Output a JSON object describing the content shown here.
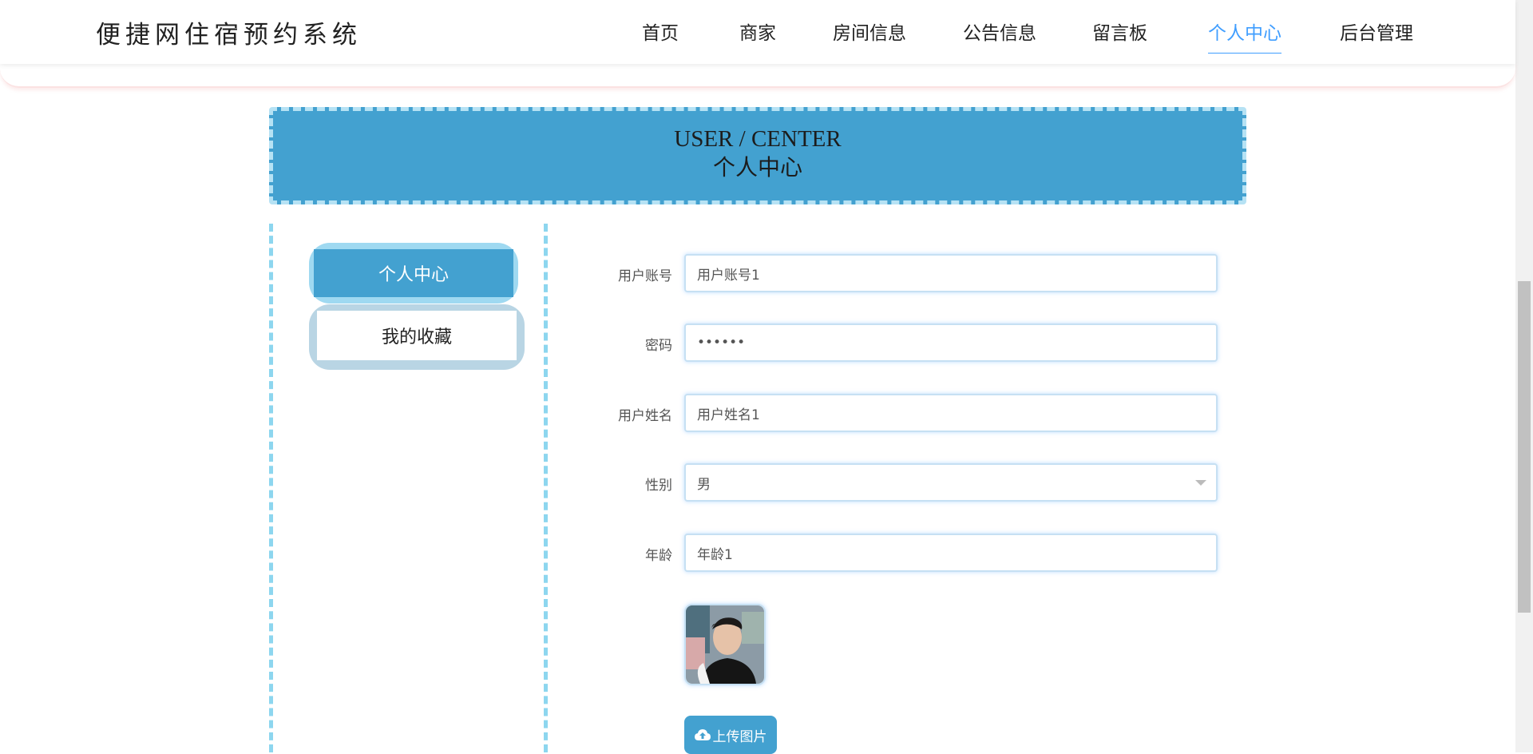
{
  "site": {
    "title": "便捷网住宿预约系统"
  },
  "nav": {
    "items": [
      {
        "label": "首页",
        "active": false
      },
      {
        "label": "商家",
        "active": false
      },
      {
        "label": "房间信息",
        "active": false
      },
      {
        "label": "公告信息",
        "active": false
      },
      {
        "label": "留言板",
        "active": false
      },
      {
        "label": "个人中心",
        "active": true
      },
      {
        "label": "后台管理",
        "active": false
      }
    ]
  },
  "banner": {
    "en": "USER / CENTER",
    "cn": "个人中心"
  },
  "sidebar": {
    "items": [
      {
        "label": "个人中心",
        "active": true
      },
      {
        "label": "我的收藏",
        "active": false
      }
    ]
  },
  "form": {
    "account": {
      "label": "用户账号",
      "value": "用户账号1"
    },
    "password": {
      "label": "密码",
      "value": "••••••"
    },
    "name": {
      "label": "用户姓名",
      "value": "用户姓名1"
    },
    "gender": {
      "label": "性别",
      "value": "男"
    },
    "age": {
      "label": "年龄",
      "value": "年龄1"
    },
    "upload_label": "上传图片"
  },
  "colors": {
    "accent": "#43a1d0",
    "nav_active": "#409eff",
    "dash": "#8dd6ef"
  }
}
